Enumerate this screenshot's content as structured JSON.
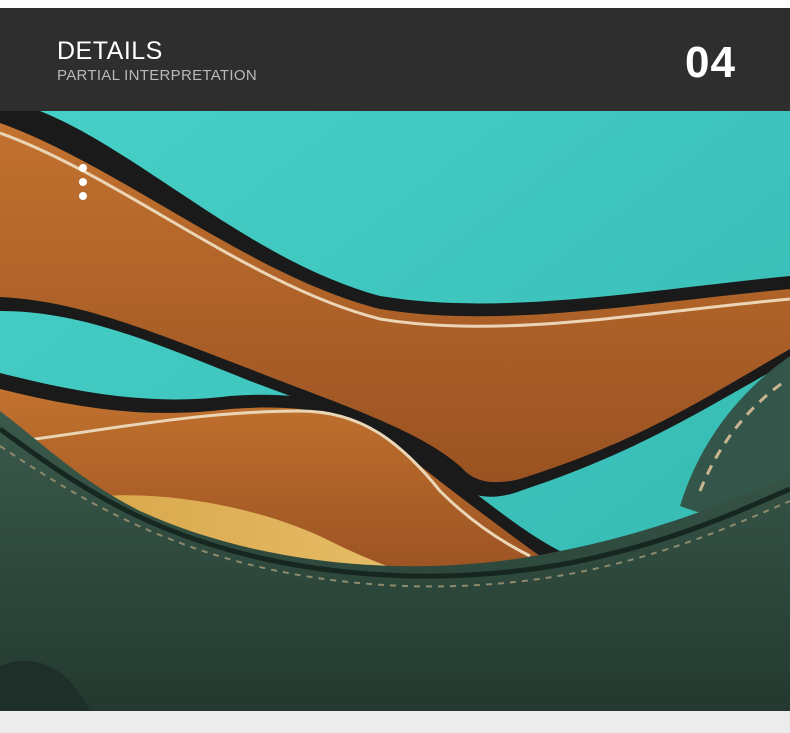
{
  "header": {
    "title": "DETAILS",
    "subtitle": "PARTIAL INTERPRETATION",
    "number": "04"
  },
  "colors": {
    "header_bg": "#2e2e2e",
    "backdrop_teal": "#3ec8c0",
    "leather_tan": "#b8682e",
    "leather_green": "#2f4a3e",
    "stitching": "#e6d3b6"
  }
}
